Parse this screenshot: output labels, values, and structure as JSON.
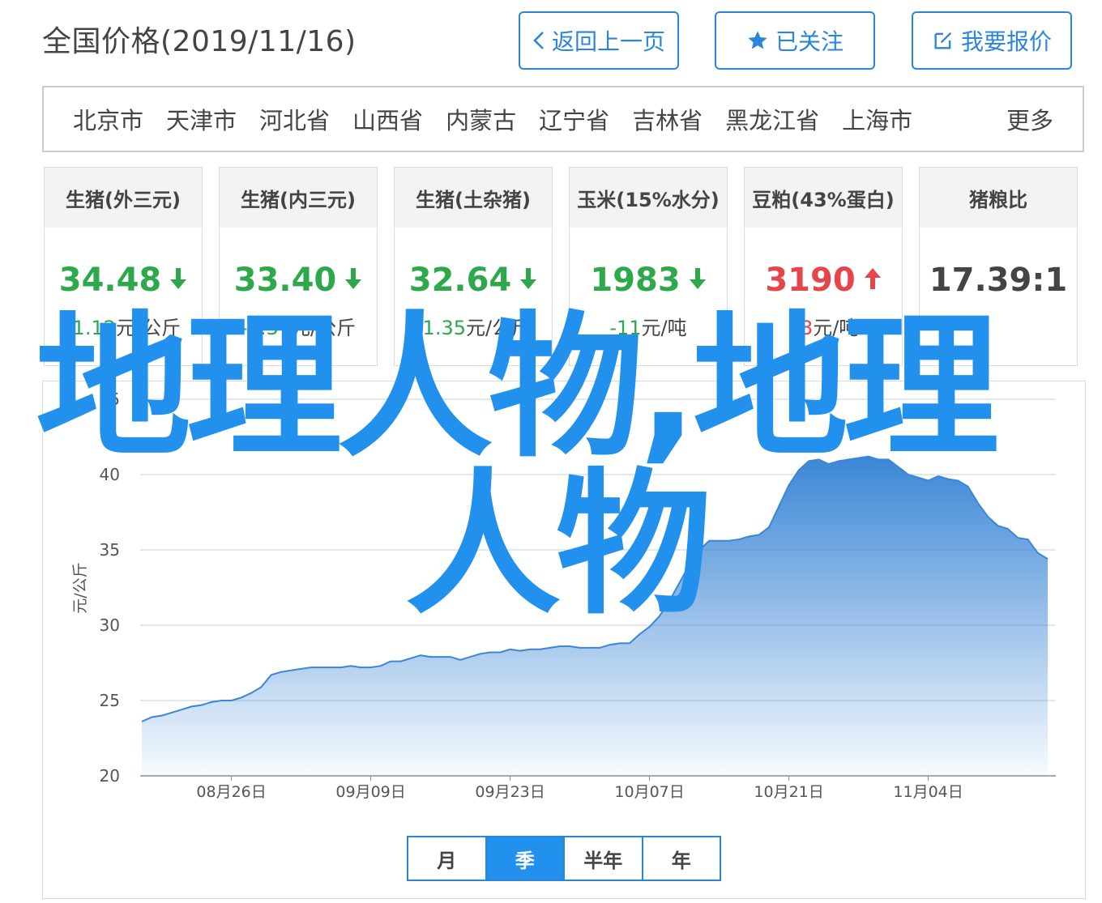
{
  "header": {
    "title": "全国价格(2019/11/16)",
    "back_label": "返回上一页",
    "follow_label": "已关注",
    "report_label": "我要报价"
  },
  "regions": {
    "items": [
      "北京市",
      "天津市",
      "河北省",
      "山西省",
      "内蒙古",
      "辽宁省",
      "吉林省",
      "黑龙江省",
      "上海市"
    ],
    "more_label": "更多"
  },
  "cards": [
    {
      "title": "生猪(外三元)",
      "value": "34.48",
      "trend": "down",
      "change": "-1.12",
      "unit": "元/公斤"
    },
    {
      "title": "生猪(内三元)",
      "value": "33.40",
      "trend": "down",
      "change": "-1.37",
      "unit": "元/公斤"
    },
    {
      "title": "生猪(土杂猪)",
      "value": "32.64",
      "trend": "down",
      "change": "-1.35",
      "unit": "元/公斤"
    },
    {
      "title": "玉米(15%水分)",
      "value": "1983",
      "trend": "down",
      "change": "-11",
      "unit": "元/吨"
    },
    {
      "title": "豆粕(43%蛋白)",
      "value": "3190",
      "trend": "up",
      "change": "13",
      "unit": "元/吨"
    },
    {
      "title": "猪粮比",
      "value": "17.39:1",
      "trend": "none",
      "change": "",
      "unit": ""
    }
  ],
  "colors": {
    "accent": "#2b86d9",
    "down": "#2da84a",
    "up": "#e8454b",
    "watermark": "#2291ee",
    "area_top": "#3b86d6"
  },
  "watermark": {
    "line1": "地理人物,地理",
    "line2": "人物"
  },
  "chart_data": {
    "type": "area",
    "ylabel": "元/公斤",
    "ylim": [
      20,
      45
    ],
    "yticks": [
      "20",
      "25",
      "30",
      "35",
      "40",
      "45"
    ],
    "xticks": [
      "08月26日",
      "09月09日",
      "09月23日",
      "10月07日",
      "10月21日",
      "11月04日"
    ],
    "grid": true,
    "series": [
      {
        "x": [
          "08月17日",
          "08月18日",
          "08月19日",
          "08月20日",
          "08月21日",
          "08月22日",
          "08月23日",
          "08月24日",
          "08月25日",
          "08月26日",
          "08月27日",
          "08月28日",
          "08月29日",
          "08月30日",
          "08月31日",
          "09月01日",
          "09月02日",
          "09月03日",
          "09月04日",
          "09月05日",
          "09月06日",
          "09月07日",
          "09月08日",
          "09月09日",
          "09月10日",
          "09月11日",
          "09月12日",
          "09月13日",
          "09月14日",
          "09月15日",
          "09月16日",
          "09月17日",
          "09月18日",
          "09月19日",
          "09月20日",
          "09月21日",
          "09月22日",
          "09月23日",
          "09月24日",
          "09月25日",
          "09月26日",
          "09月27日",
          "09月28日",
          "09月29日",
          "09月30日",
          "10月01日",
          "10月02日",
          "10月03日",
          "10月04日",
          "10月05日",
          "10月06日",
          "10月07日",
          "10月08日",
          "10月09日",
          "10月10日",
          "10月11日",
          "10月12日",
          "10月13日",
          "10月14日",
          "10月15日",
          "10月16日",
          "10月17日",
          "10月18日",
          "10月19日",
          "10月20日",
          "10月21日",
          "10月22日",
          "10月23日",
          "10月24日",
          "10月25日",
          "10月26日",
          "10月27日",
          "10月28日",
          "10月29日",
          "10月30日",
          "10月31日",
          "11月01日",
          "11月02日",
          "11月03日",
          "11月04日",
          "11月05日",
          "11月06日",
          "11月07日",
          "11月08日",
          "11月09日",
          "11月10日",
          "11月11日",
          "11月12日",
          "11月13日",
          "11月14日",
          "11月15日",
          "11月16日"
        ],
        "values": [
          23.6,
          23.9,
          24.0,
          24.2,
          24.4,
          24.6,
          24.7,
          24.9,
          25.0,
          25.0,
          25.2,
          25.5,
          25.9,
          26.7,
          26.9,
          27.0,
          27.1,
          27.2,
          27.2,
          27.2,
          27.2,
          27.3,
          27.2,
          27.2,
          27.3,
          27.6,
          27.6,
          27.8,
          28.0,
          27.9,
          27.9,
          27.9,
          27.7,
          27.9,
          28.1,
          28.2,
          28.2,
          28.4,
          28.3,
          28.4,
          28.4,
          28.5,
          28.6,
          28.6,
          28.5,
          28.5,
          28.5,
          28.7,
          28.8,
          28.8,
          29.4,
          29.9,
          30.6,
          31.6,
          32.8,
          34.0,
          35.0,
          35.6,
          35.6,
          35.6,
          35.7,
          35.9,
          36.0,
          36.5,
          37.9,
          39.3,
          40.3,
          40.9,
          41.0,
          40.7,
          40.9,
          41.0,
          41.1,
          41.2,
          41.0,
          41.0,
          40.5,
          40.0,
          39.8,
          39.6,
          39.9,
          39.7,
          39.6,
          39.2,
          38.1,
          37.2,
          36.6,
          36.4,
          35.8,
          35.7,
          34.8,
          34.4
        ]
      }
    ]
  },
  "period_tabs": {
    "items": [
      "月",
      "季",
      "半年",
      "年"
    ],
    "active": "季"
  }
}
